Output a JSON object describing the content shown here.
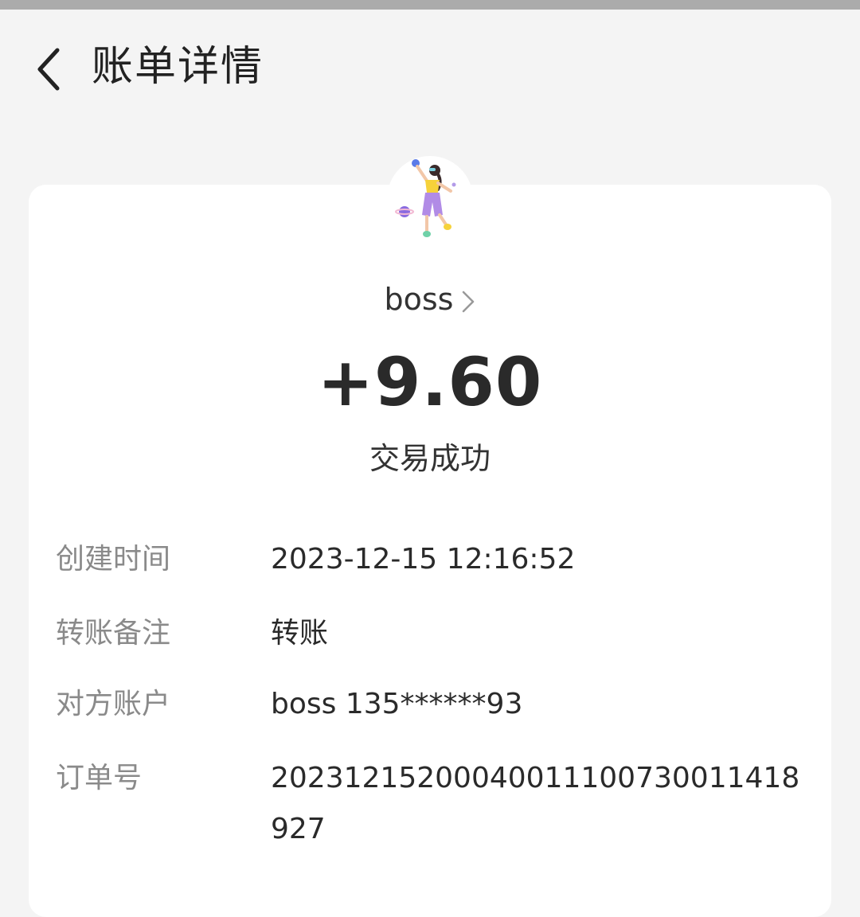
{
  "header": {
    "title": "账单详情",
    "back_icon": "chevron-left-icon"
  },
  "transaction": {
    "payee": "boss",
    "amount": "+9.60",
    "status": "交易成功",
    "avatar_icon": "illustrated-girl-avatar"
  },
  "details": [
    {
      "label": "创建时间",
      "value": "2023-12-15 12:16:52"
    },
    {
      "label": "转账备注",
      "value": "转账"
    },
    {
      "label": "对方账户",
      "value": "boss 135******93"
    },
    {
      "label": "订单号",
      "value": "20231215200040011100730011418927"
    }
  ],
  "colors": {
    "background": "#f4f4f4",
    "card": "#ffffff",
    "label": "#8a8a8a",
    "text": "#2a2a2a"
  }
}
